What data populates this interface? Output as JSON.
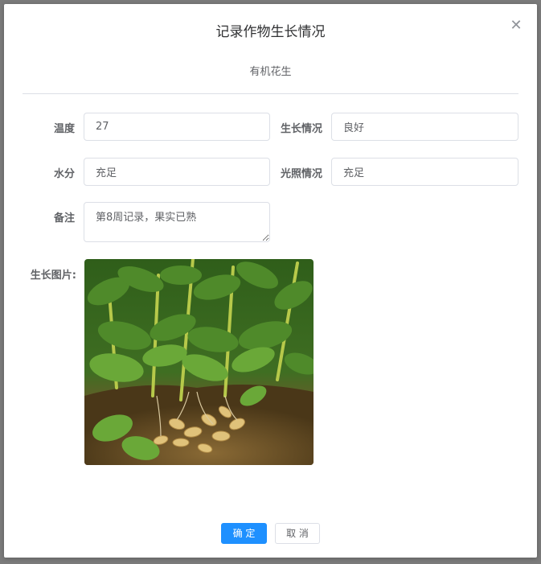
{
  "dialog": {
    "title": "记录作物生长情况",
    "subtitle": "有机花生",
    "close_icon": "close-icon"
  },
  "form": {
    "temperature": {
      "label": "温度",
      "value": "27"
    },
    "growth": {
      "label": "生长情况",
      "value": "良好"
    },
    "moisture": {
      "label": "水分",
      "value": "充足"
    },
    "light": {
      "label": "光照情况",
      "value": "充足"
    },
    "remarks": {
      "label": "备注",
      "value": "第8周记录，果实已熟"
    },
    "photo": {
      "label": "生长图片:",
      "icon": "peanut-plant-photo"
    }
  },
  "footer": {
    "confirm_label": "确 定",
    "cancel_label": "取 消"
  },
  "colors": {
    "primary": "#1e90ff",
    "border": "#dcdfe6",
    "text": "#606266"
  }
}
